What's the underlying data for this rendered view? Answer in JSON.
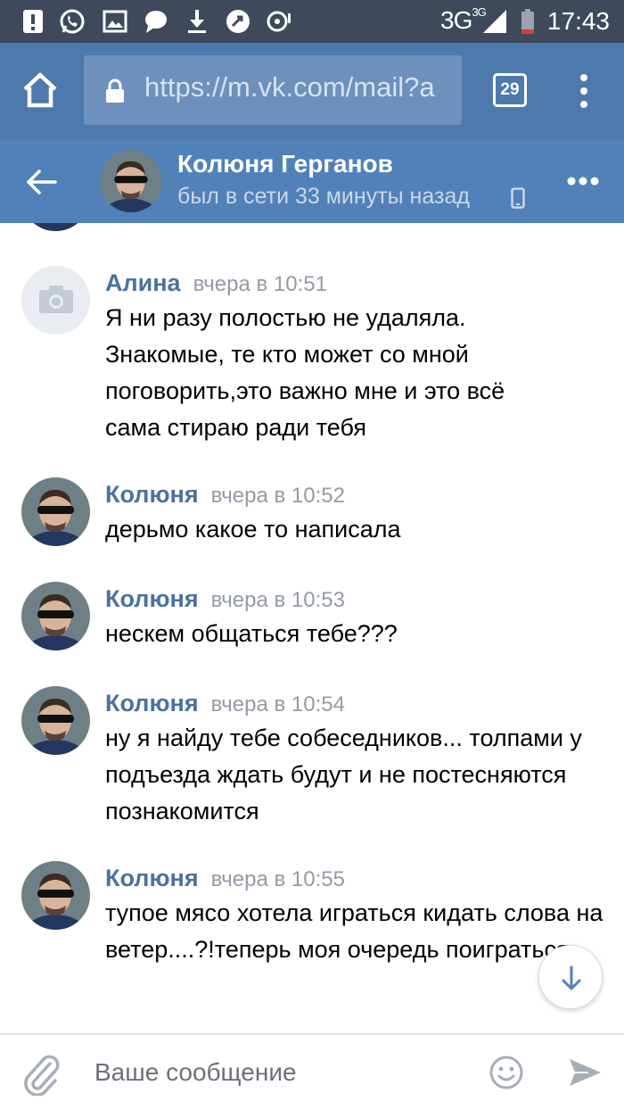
{
  "status_bar": {
    "network": "3G",
    "network_sup": "3G",
    "time": "17:43",
    "icons": [
      "alert-icon",
      "whatsapp-icon",
      "gallery-icon",
      "chat-icon",
      "download-icon",
      "vpn-icon",
      "sync-icon",
      "signal-icon",
      "battery-icon"
    ]
  },
  "browser": {
    "url": "https://m.vk.com/mail?a",
    "tab_count": "29"
  },
  "chat_header": {
    "name": "Колюня Герганов",
    "status": "был в сети 33 минуты назад"
  },
  "messages": [
    {
      "author": "Алина",
      "time": "вчера в 10:51",
      "avatar": "camera-icon",
      "text": "Я ни разу полостью не удаляла. Знакомые, те кто может со мной поговорить,это важно мне и это всё сама стираю ради тебя"
    },
    {
      "author": "Колюня",
      "time": "вчера в 10:52",
      "avatar": "photo",
      "text": "дерьмо какое то написала"
    },
    {
      "author": "Колюня",
      "time": "вчера в 10:53",
      "avatar": "photo",
      "text": "нескем общаться тебе???"
    },
    {
      "author": "Колюня",
      "time": "вчера в 10:54",
      "avatar": "photo",
      "text": "ну я найду тебе собеседников... толпами у подъезда ждать будут и не постесняются познакомится"
    },
    {
      "author": "Колюня",
      "time": "вчера в 10:55",
      "avatar": "photo",
      "text": "тупое мясо хотела играться кидать слова на ветер....?!теперь моя очередь поиграться"
    }
  ],
  "composer": {
    "placeholder": "Ваше сообщение"
  },
  "colors": {
    "status_bar": "#3e4a5c",
    "browser_bar": "#4e79ad",
    "vk_header": "#5181b8",
    "author_name": "#4a72a1",
    "timestamp": "#939ba6"
  }
}
